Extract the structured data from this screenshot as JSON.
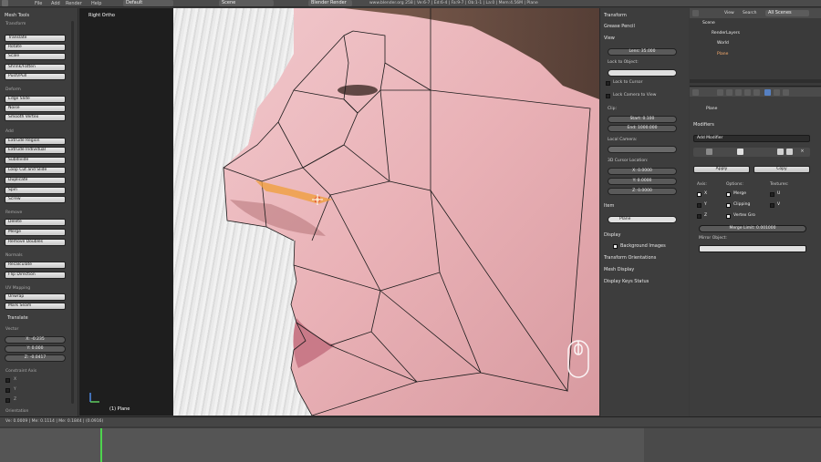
{
  "topbar": {
    "menu": [
      "File",
      "Add",
      "Render",
      "Help"
    ],
    "screen_layout": "Default",
    "scene": "Scene",
    "render_engine": "Blender Render",
    "info": "www.blender.org 258 | Ve:6-7 | Ed:6-4 | Fa:9-7 | Ob:1-1 | La:0 | Mem:4.56M | Plane"
  },
  "tools": {
    "title": "Mesh Tools",
    "transform_title": "Transform",
    "transform_buttons": [
      "Translate",
      "Rotate",
      "Scale",
      "Shrink/Fatten",
      "Push/Pull"
    ],
    "deform_title": "Deform",
    "deform_buttons": [
      "Edge Slide",
      "Noise",
      "Smooth Vertex"
    ],
    "add_title": "Add",
    "add_buttons": [
      "Extrude Region",
      "Extrude Individual",
      "Subdivide",
      "Loop Cut and Slide",
      "Duplicate",
      "Spin",
      "Screw"
    ],
    "remove_title": "Remove",
    "remove_buttons": [
      "Delete",
      "Merge",
      "Remove Doubles"
    ],
    "normals_title": "Normals",
    "normals_buttons": [
      "Recalculate",
      "Flip Direction"
    ],
    "uv_title": "UV Mapping",
    "uv_buttons": [
      "Unwrap",
      "Mark Seam"
    ],
    "translate_title": "Translate",
    "vector_label": "Vector",
    "vector": [
      "X: -0.235",
      "Y: 0.000",
      "Z: -0.0417"
    ],
    "constraint_label": "Constraint Axis",
    "constraint_axes": [
      "X",
      "Y",
      "Z"
    ],
    "orientation_label": "Orientation"
  },
  "viewport": {
    "view_name": "Right Ortho",
    "object_label": "(1) Plane"
  },
  "properties": {
    "transform": "Transform",
    "grease_pencil": "Grease Pencil",
    "view": "View",
    "lens": "Lens: 35.000",
    "lock_to_object": "Lock to Object:",
    "lock_to_cursor": "Lock to Cursor",
    "lock_camera": "Lock Camera to View",
    "clip": "Clip:",
    "clip_start": "Start: 0.100",
    "clip_end": "End: 1000.000",
    "local_camera": "Local Camera:",
    "cursor_location": "3D Cursor Location:",
    "cursor": [
      "X: 0.0000",
      "Y: 0.0000",
      "Z: 0.0000"
    ],
    "item": "Item",
    "item_name": "Plane",
    "display": "Display",
    "background_images": "Background Images",
    "transform_orientations": "Transform Orientations",
    "mesh_display": "Mesh Display",
    "display_keys": "Display Keys Status"
  },
  "outliner": {
    "view_menu": "View",
    "search_menu": "Search",
    "filter": "All Scenes",
    "items": [
      "Scene",
      "RenderLayers",
      "World",
      "Plane"
    ]
  },
  "prop_editor": {
    "breadcrumb": "Plane",
    "modifiers_title": "Modifiers",
    "add_modifier": "Add Modifier",
    "apply": "Apply",
    "copy": "Copy",
    "axis_label": "Axis:",
    "options_label": "Options:",
    "textures_label": "Textures:",
    "axes": [
      "X",
      "Y",
      "Z"
    ],
    "options": [
      "Merge",
      "Clipping",
      "Vertex Gro"
    ],
    "textures": [
      "U",
      "V"
    ],
    "merge_limit": "Merge Limit: 0.001000",
    "mirror_object": "Mirror Object:"
  },
  "timeline": {
    "status": "Ve: 0.0009 | Me: 0.1114 | Me: 0.1844 | (0.0916)"
  },
  "colors": {
    "accent": "#5680c2",
    "selected_edge": "#f0a040"
  }
}
